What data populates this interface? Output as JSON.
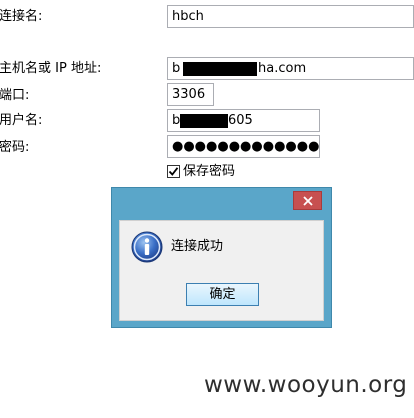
{
  "form": {
    "connection_name_label": "连接名:",
    "connection_name_value": "hbch",
    "host_label": "主机名或 IP 地址:",
    "host_value_prefix": "b",
    "host_value_suffix": "ha.com",
    "port_label": "端口:",
    "port_value": "3306",
    "username_label": "用户名:",
    "username_value_prefix": "b",
    "username_value_suffix": "605",
    "password_label": "密码:",
    "password_value": "●●●●●●●●●●●●●●●●",
    "save_password_label": "保存密码",
    "save_password_checked": true
  },
  "dialog": {
    "message": "连接成功",
    "ok_label": "确定",
    "icon": "info-icon"
  },
  "watermark": "www.wooyun.org",
  "colors": {
    "titlebar": "#5aa6c9",
    "close_button": "#c75050",
    "info_icon": "#1f4f9e"
  }
}
